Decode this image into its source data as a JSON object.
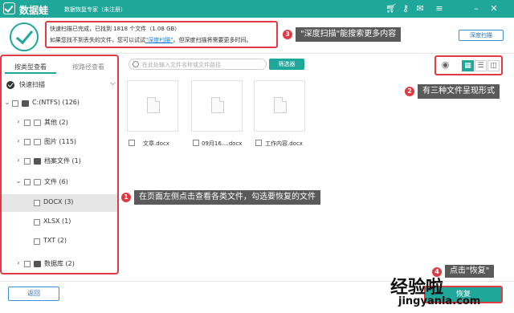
{
  "app": {
    "name": "数据蛙",
    "subtitle": "数据恢复专家（未注册）"
  },
  "titlebar_icons": [
    "cart-icon",
    "key-icon",
    "chat-icon",
    "menu-icon",
    "minimize-icon",
    "close-icon"
  ],
  "status": {
    "line1": "快速扫描已完成，已找到 1818 个文件（1.08 GB）",
    "line2_pre": "如果您找不到丢失的文件，您可以试试",
    "line2_link": "\"深度扫描\"",
    "line2_post": "。但深度扫描将需要更多时间。"
  },
  "deep_scan_button": "深度扫描",
  "annotations": {
    "a1": {
      "num": "1",
      "text": "在页面左侧点击查看各类文件，勾选要恢复的文件"
    },
    "a2": {
      "num": "2",
      "text": "有三种文件呈现形式"
    },
    "a3": {
      "num": "3",
      "text": "\"深度扫描\"能搜索更多内容"
    },
    "a4": {
      "num": "4",
      "text": "点击\"恢复\""
    }
  },
  "sidebar": {
    "tabs": [
      "按类型查看",
      "按路径查看"
    ],
    "quick_scan": "快速扫描",
    "tree": [
      {
        "label": "C:(NTFS) (126)",
        "level": 0,
        "expanded": true,
        "icon": "drive-icon"
      },
      {
        "label": "其他 (2)",
        "level": 1,
        "expanded": false,
        "icon": "folder-icon"
      },
      {
        "label": "图片 (115)",
        "level": 1,
        "expanded": false,
        "icon": "image-icon"
      },
      {
        "label": "档案文件 (1)",
        "level": 1,
        "expanded": false,
        "icon": "archive-icon"
      },
      {
        "label": "文件 (6)",
        "level": 1,
        "expanded": true,
        "icon": "document-icon"
      },
      {
        "label": "DOCX (3)",
        "level": 2,
        "selected": true
      },
      {
        "label": "XLSX (1)",
        "level": 2
      },
      {
        "label": "TXT (2)",
        "level": 2
      },
      {
        "label": "数据库 (2)",
        "level": 1,
        "expanded": false,
        "icon": "database-icon"
      }
    ]
  },
  "search": {
    "placeholder": "在此处输入文件名称或文件路径"
  },
  "filter_button": "筛选器",
  "view_modes": [
    "preview-icon",
    "grid-view-icon",
    "list-view-icon",
    "detail-view-icon"
  ],
  "files": [
    {
      "name": "文章.docx"
    },
    {
      "name": "09月16....docx"
    },
    {
      "name": "工作内容.docx"
    }
  ],
  "back_button": "返回",
  "recover_button": "恢复",
  "watermark": {
    "main": "经验啦",
    "url": "jingyanla.com"
  },
  "colors": {
    "brand": "#1fa79a",
    "highlight": "#e03a45",
    "callout_bg": "#5a5a5a",
    "link": "#1f7fd6"
  }
}
